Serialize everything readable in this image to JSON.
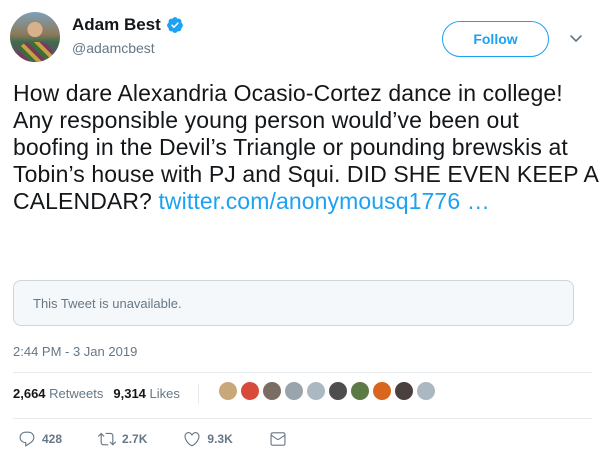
{
  "user": {
    "name": "Adam Best",
    "handle": "@adamcbest"
  },
  "follow_label": "Follow",
  "tweet": {
    "text": "How dare Alexandria Ocasio-Cortez dance in college! Any responsible young person would’ve been out boofing in the Devil’s Triangle or pounding brewskis at Tobin’s house with PJ and Squi. DID SHE EVEN KEEP A CALENDAR? ",
    "link": "twitter.com/anonymousq1776 …"
  },
  "quoted": "This Tweet is unavailable.",
  "timestamp": "2:44 PM - 3 Jan 2019",
  "stats": {
    "retweets_count": "2,664",
    "retweets_label": "Retweets",
    "likes_count": "9,314",
    "likes_label": "Likes"
  },
  "likers_colors": [
    "#c8a878",
    "#d84a3a",
    "#7a6e64",
    "#9aa4ad",
    "#aab8c2",
    "#4e4e4e",
    "#5b7a45",
    "#d8661e",
    "#4a4040",
    "#aab8c2"
  ],
  "actions": {
    "reply_count": "428",
    "retweet_count": "2.7K",
    "like_count": "9.3K"
  },
  "colors": {
    "accent": "#1da1f2",
    "muted": "#657786"
  }
}
